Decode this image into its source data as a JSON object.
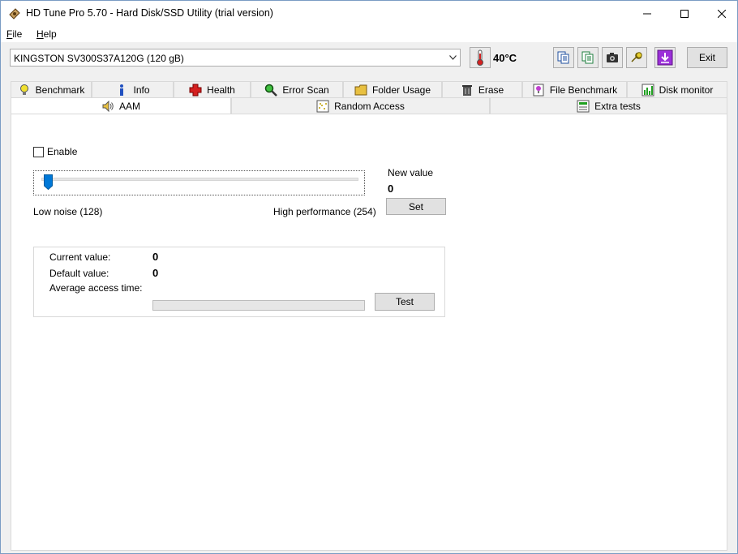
{
  "window": {
    "title": "HD Tune Pro 5.70 - Hard Disk/SSD Utility (trial version)"
  },
  "menu": {
    "file_first": "F",
    "file_rest": "ile",
    "help_first": "H",
    "help_rest": "elp"
  },
  "toolbar": {
    "drive": "KINGSTON SV300S37A120G (120 gB)",
    "temperature": "40°C",
    "exit_label": "Exit"
  },
  "tabs_row1": [
    {
      "label": "Benchmark",
      "icon": "bulb-icon"
    },
    {
      "label": "Info",
      "icon": "info-icon"
    },
    {
      "label": "Health",
      "icon": "health-cross-icon"
    },
    {
      "label": "Error Scan",
      "icon": "magnifier-icon"
    },
    {
      "label": "Folder Usage",
      "icon": "folder-icon"
    },
    {
      "label": "Erase",
      "icon": "trash-icon"
    },
    {
      "label": "File Benchmark",
      "icon": "file-benchmark-icon"
    },
    {
      "label": "Disk monitor",
      "icon": "disk-monitor-icon"
    }
  ],
  "tabs_row2": [
    {
      "label": "AAM",
      "icon": "speaker-icon",
      "active": true
    },
    {
      "label": "Random Access",
      "icon": "random-access-icon"
    },
    {
      "label": "Extra tests",
      "icon": "extra-tests-icon"
    }
  ],
  "aam": {
    "enable_label": "Enable",
    "enabled": false,
    "slider_value": 128,
    "slider_min": 128,
    "slider_max": 254,
    "low_label": "Low noise (128)",
    "high_label": "High performance (254)",
    "new_value_label": "New value",
    "new_value": "0",
    "set_label": "Set",
    "current_value_label": "Current value:",
    "current_value": "0",
    "default_value_label": "Default value:",
    "default_value": "0",
    "avg_access_label": "Average access time:",
    "progress": 0,
    "test_label": "Test"
  },
  "colors": {
    "accent_purple": "#9b30d9",
    "temp_red": "#d42020",
    "progress_green": "#06b025"
  }
}
